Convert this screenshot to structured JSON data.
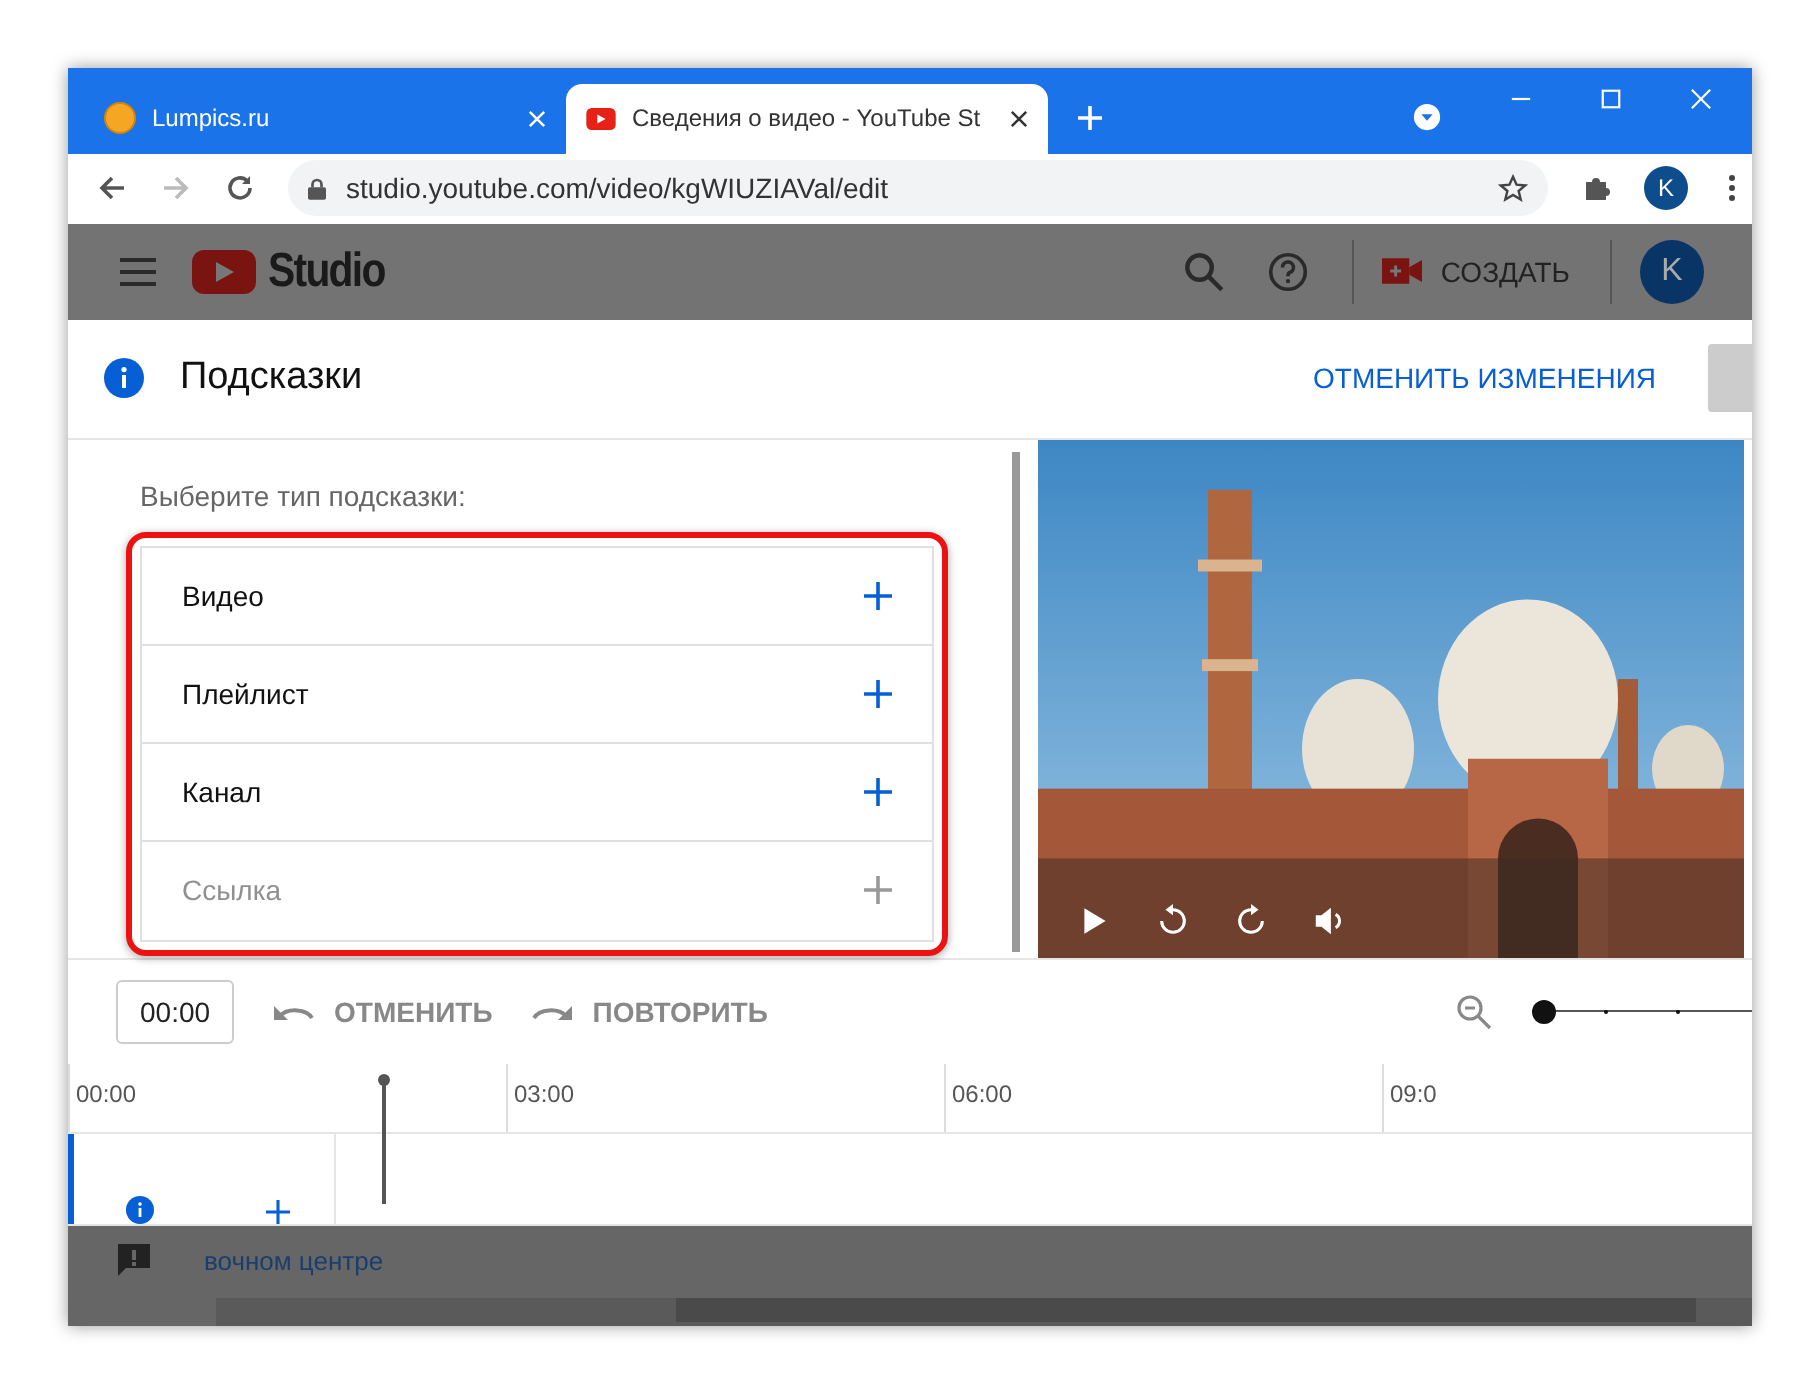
{
  "browser": {
    "tabs": [
      {
        "title": "Lumpics.ru",
        "selected": false
      },
      {
        "title": "Сведения о видео - YouTube St",
        "selected": true
      }
    ],
    "url": "studio.youtube.com/video/kgWIUZIAVal/edit",
    "profile_initial": "K"
  },
  "studio_header": {
    "logo_text": "Studio",
    "create_label": "СОЗДАТЬ",
    "avatar_initial": "K"
  },
  "dialog": {
    "title": "Подсказки",
    "discard_label": "ОТМЕНИТЬ ИЗМЕНЕНИЯ",
    "prompt": "Выберите тип подсказки:",
    "highlighted": true,
    "hint_types": [
      {
        "label": "Видео",
        "disabled": false
      },
      {
        "label": "Плейлист",
        "disabled": false
      },
      {
        "label": "Канал",
        "disabled": false
      },
      {
        "label": "Ссылка",
        "disabled": true
      }
    ]
  },
  "timeline": {
    "time": "00:00",
    "undo_label": "ОТМЕНИТЬ",
    "redo_label": "ПОВТОРИТЬ",
    "ticks": [
      "00:00",
      "03:00",
      "06:00",
      "09:0"
    ],
    "zoom": {
      "level": 0
    }
  },
  "background": {
    "text": "вочном центре"
  }
}
